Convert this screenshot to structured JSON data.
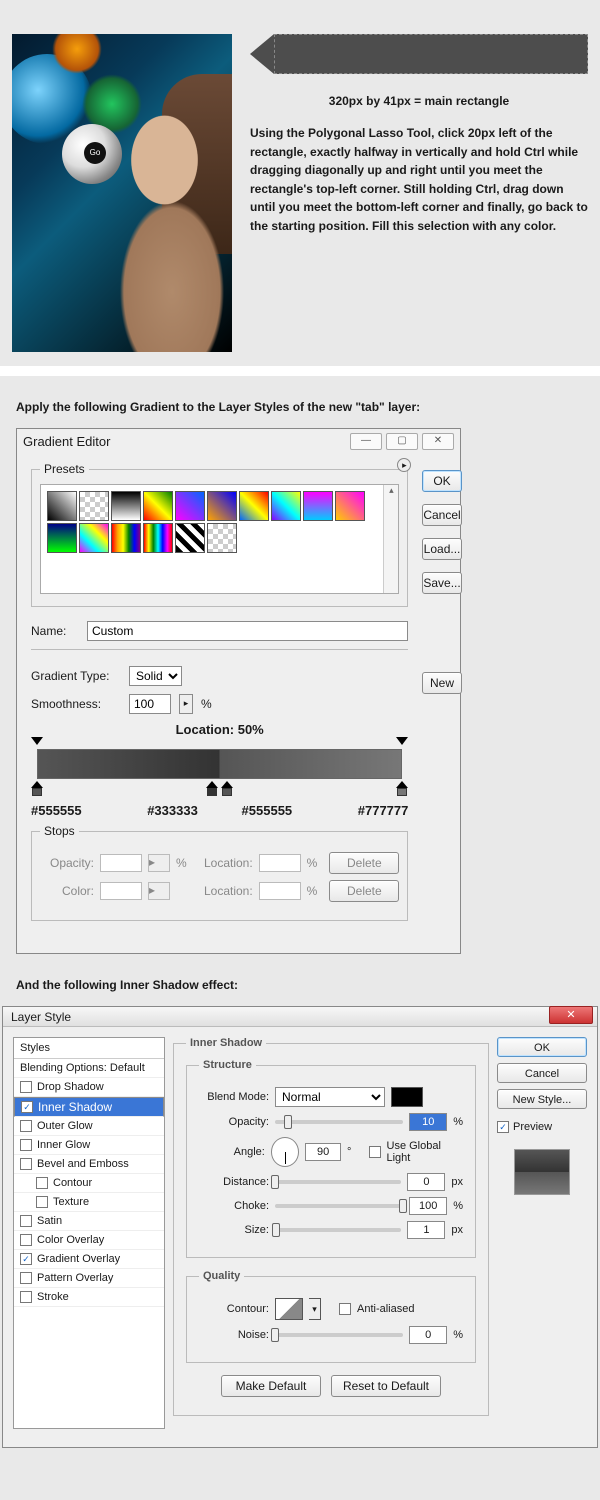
{
  "hero": {
    "ball_text": "Go",
    "dims": "320px by 41px = main rectangle",
    "instructions": "Using the Polygonal Lasso Tool, click 20px left of the rectangle, exactly halfway in vertically and hold Ctrl while dragging diagonally up and right until you meet the rectangle's top-left corner. Still holding Ctrl, drag down until you meet the bottom-left corner and finally, go back to the starting position. Fill this selection with any color."
  },
  "instr_gradient": "Apply the following Gradient to the Layer Styles of the new \"tab\" layer:",
  "instr_shadow": "And the following Inner Shadow effect:",
  "gradient_editor": {
    "title": "Gradient Editor",
    "win": {
      "min": "—",
      "max": "▢",
      "close": "✕"
    },
    "presets_label": "Presets",
    "btn_ok": "OK",
    "btn_cancel": "Cancel",
    "btn_load": "Load...",
    "btn_save": "Save...",
    "name_label": "Name:",
    "name_value": "Custom",
    "btn_new": "New",
    "type_label": "Gradient Type:",
    "type_value": "Solid",
    "smooth_label": "Smoothness:",
    "smooth_value": "100",
    "smooth_unit": "%",
    "location_label": "Location: 50%",
    "stops": {
      "c1": "#555555",
      "c2": "#333333",
      "c3": "#555555",
      "c4": "#777777"
    },
    "stops_fs": "Stops",
    "opacity_label": "Opacity:",
    "loc_label": "Location:",
    "pct": "%",
    "color_label": "Color:",
    "btn_delete": "Delete",
    "presets_menu": "▸"
  },
  "layer_style": {
    "title": "Layer Style",
    "close": "✕",
    "styles_hd": "Styles",
    "blending": "Blending Options: Default",
    "items": [
      {
        "label": "Drop Shadow",
        "checked": false,
        "sel": false
      },
      {
        "label": "Inner Shadow",
        "checked": true,
        "sel": true
      },
      {
        "label": "Outer Glow",
        "checked": false,
        "sel": false
      },
      {
        "label": "Inner Glow",
        "checked": false,
        "sel": false
      },
      {
        "label": "Bevel and Emboss",
        "checked": false,
        "sel": false
      },
      {
        "label": "Contour",
        "checked": false,
        "sel": false,
        "sub": true
      },
      {
        "label": "Texture",
        "checked": false,
        "sel": false,
        "sub": true
      },
      {
        "label": "Satin",
        "checked": false,
        "sel": false
      },
      {
        "label": "Color Overlay",
        "checked": false,
        "sel": false
      },
      {
        "label": "Gradient Overlay",
        "checked": true,
        "sel": false
      },
      {
        "label": "Pattern Overlay",
        "checked": false,
        "sel": false
      },
      {
        "label": "Stroke",
        "checked": false,
        "sel": false
      }
    ],
    "panel_title": "Inner Shadow",
    "structure": "Structure",
    "blend_mode_l": "Blend Mode:",
    "blend_mode_v": "Normal",
    "opacity_l": "Opacity:",
    "opacity_v": "10",
    "pct": "%",
    "angle_l": "Angle:",
    "angle_v": "90",
    "deg": "°",
    "ugl": "Use Global Light",
    "distance_l": "Distance:",
    "distance_v": "0",
    "px": "px",
    "choke_l": "Choke:",
    "choke_v": "100",
    "size_l": "Size:",
    "size_v": "1",
    "quality": "Quality",
    "contour_l": "Contour:",
    "aa": "Anti-aliased",
    "noise_l": "Noise:",
    "noise_v": "0",
    "make_default": "Make Default",
    "reset_default": "Reset to Default",
    "btn_ok": "OK",
    "btn_cancel": "Cancel",
    "btn_newstyle": "New Style...",
    "preview_l": "Preview"
  }
}
